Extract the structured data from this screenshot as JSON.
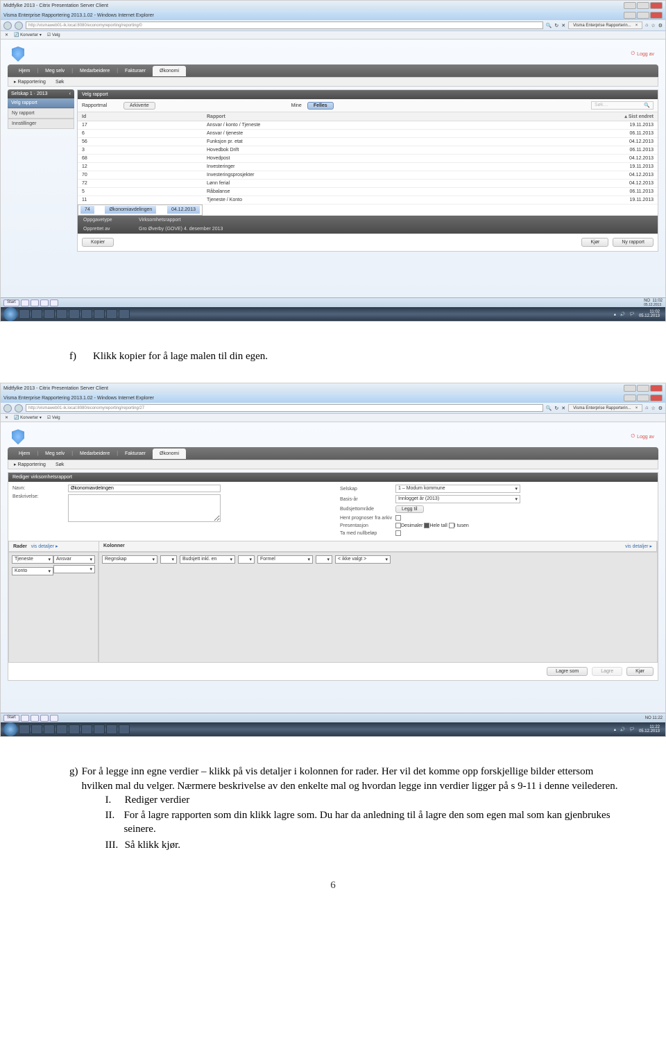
{
  "page_number": "6",
  "screenshot1": {
    "citrix_title": "Midtfylke 2013 - Citrix Presentation Server Client",
    "ie_title": "Visma Enterprise Rapportering 2013.1.02 - Windows Internet Explorer",
    "url": "http://vismaweb01-ik.local:8080/economyreporting/reporting/0",
    "tab_label": "Visma Enterprise Rapporterin...",
    "konverter": "Konverter",
    "velg": "Velg",
    "loggav": "Logg av",
    "nav": {
      "hjem": "Hjem",
      "meg_selv": "Meg selv",
      "medarbeidere": "Medarbeidere",
      "fakturaer": "Fakturaer",
      "okonomi": "Økonomi"
    },
    "subnav": {
      "rapportering": "Rapportering",
      "sok": "Søk"
    },
    "sidebar": {
      "title": "Selskap 1 · 2013",
      "active": "Velg rapport",
      "item2": "Ny rapport",
      "item3": "Innstillinger"
    },
    "panel_title": "Velg rapport",
    "filter": {
      "label": "Rapportmal",
      "arkiverte": "Arkiverte",
      "mine": "Mine",
      "felles": "Felles",
      "search_placeholder": "Søk…"
    },
    "cols": {
      "id": "Id",
      "rapport": "Rapport",
      "endret": "Sist endret"
    },
    "rows": [
      {
        "id": "17",
        "name": "Ansvar / konto / Tjeneste",
        "date": "19.11.2013"
      },
      {
        "id": "6",
        "name": "Ansvar / tjeneste",
        "date": "06.11.2013"
      },
      {
        "id": "56",
        "name": "Funksjon pr. etat",
        "date": "04.12.2013"
      },
      {
        "id": "3",
        "name": "Hovedbok Drift",
        "date": "06.11.2013"
      },
      {
        "id": "68",
        "name": "Hovedpost",
        "date": "04.12.2013"
      },
      {
        "id": "12",
        "name": "Investeringer",
        "date": "19.11.2013"
      },
      {
        "id": "70",
        "name": "Investeringsprosjekter",
        "date": "04.12.2013"
      },
      {
        "id": "72",
        "name": "Lønn ferial",
        "date": "04.12.2013"
      },
      {
        "id": "5",
        "name": "Råbalanse",
        "date": "06.11.2013"
      },
      {
        "id": "11",
        "name": "Tjeneste / Konto",
        "date": "19.11.2013"
      },
      {
        "id": "74",
        "name": "Økonomiavdelingen",
        "date": "04.12.2013"
      }
    ],
    "info": {
      "oppgavetype_l": "Oppgavetype",
      "oppgavetype_v": "Virksomhetsrapport",
      "opprettet_l": "Opprettet av",
      "opprettet_v": "Gro Øverby (GOVE) 4. desember 2013"
    },
    "buttons": {
      "kopier": "Kopier",
      "kjor": "Kjør",
      "ny": "Ny rapport"
    },
    "start": "Start",
    "lang": "NO",
    "clock": "11:02",
    "date": "05.12.2013",
    "outer_clock": "11:02",
    "outer_date": "05.12.2013"
  },
  "text_f": "Klikk kopier for å lage malen til din egen.",
  "screenshot2": {
    "citrix_title": "Midtfylke 2013 - Citrix Presentation Server Client",
    "ie_title": "Visma Enterprise Rapportering 2013.1.02 - Windows Internet Explorer",
    "url": "http://vismaweb01-ik.local:8080/economyreporting/reporting/27",
    "tab_label": "Visma Enterprise Rapporterin...",
    "sectitle": "Rediger virksomhetsrapport",
    "labels": {
      "navn": "Navn:",
      "beskrivelse": "Beskrivelse:",
      "selskap": "Selskap",
      "basisar": "Basis-år",
      "budsjett": "Budsjettområde",
      "hent": "Hent prognoser fra arkiv",
      "presentasjon": "Presentasjon",
      "tamed": "Ta med nullbeløp"
    },
    "values": {
      "navn": "Økonomiavdelingen",
      "selskap": "1 – Modum kommune",
      "basisar": "Innlogget år (2013)",
      "leggtil": "Legg til",
      "desimaler": "Desimaler",
      "heletall": "Hele tall",
      "itusen": "I tusen"
    },
    "rader": "Rader",
    "visdetaljer": "vis detaljer ▸",
    "kolonner": "Kolonner",
    "visdetaljer2": "vis detaljer ▸",
    "rdropdowns": [
      "Tjeneste",
      "Ansvar",
      "Konto",
      ""
    ],
    "kcols": [
      "Regnskap",
      "Budsjett inkl. en",
      "Formel",
      "< ikke valgt >"
    ],
    "knums": [
      "",
      "",
      "",
      ""
    ],
    "buttons": {
      "lagresom": "Lagre som",
      "lagre": "Lagre",
      "kjor": "Kjør"
    },
    "start": "Start",
    "lang": "NO",
    "clock": "11:22",
    "date": "05.12.2013",
    "outer_clock": "11:22",
    "outer_date": "05.12.2013"
  },
  "text_g": {
    "lead": "For å legge inn egne verdier – klikk på vis detaljer i kolonnen for rader. Her vil det komme opp forskjellige bilder ettersom hvilken mal du velger. Nærmere beskrivelse av den enkelte mal og hvordan legge inn verdier ligger på s 9-11 i denne veilederen.",
    "i": "Rediger verdier",
    "ii": "For å lagre rapporten som din klikk lagre som. Du har da anledning til å lagre den som egen mal som kan gjenbrukes seinere.",
    "iii": "Så klikk kjør."
  }
}
